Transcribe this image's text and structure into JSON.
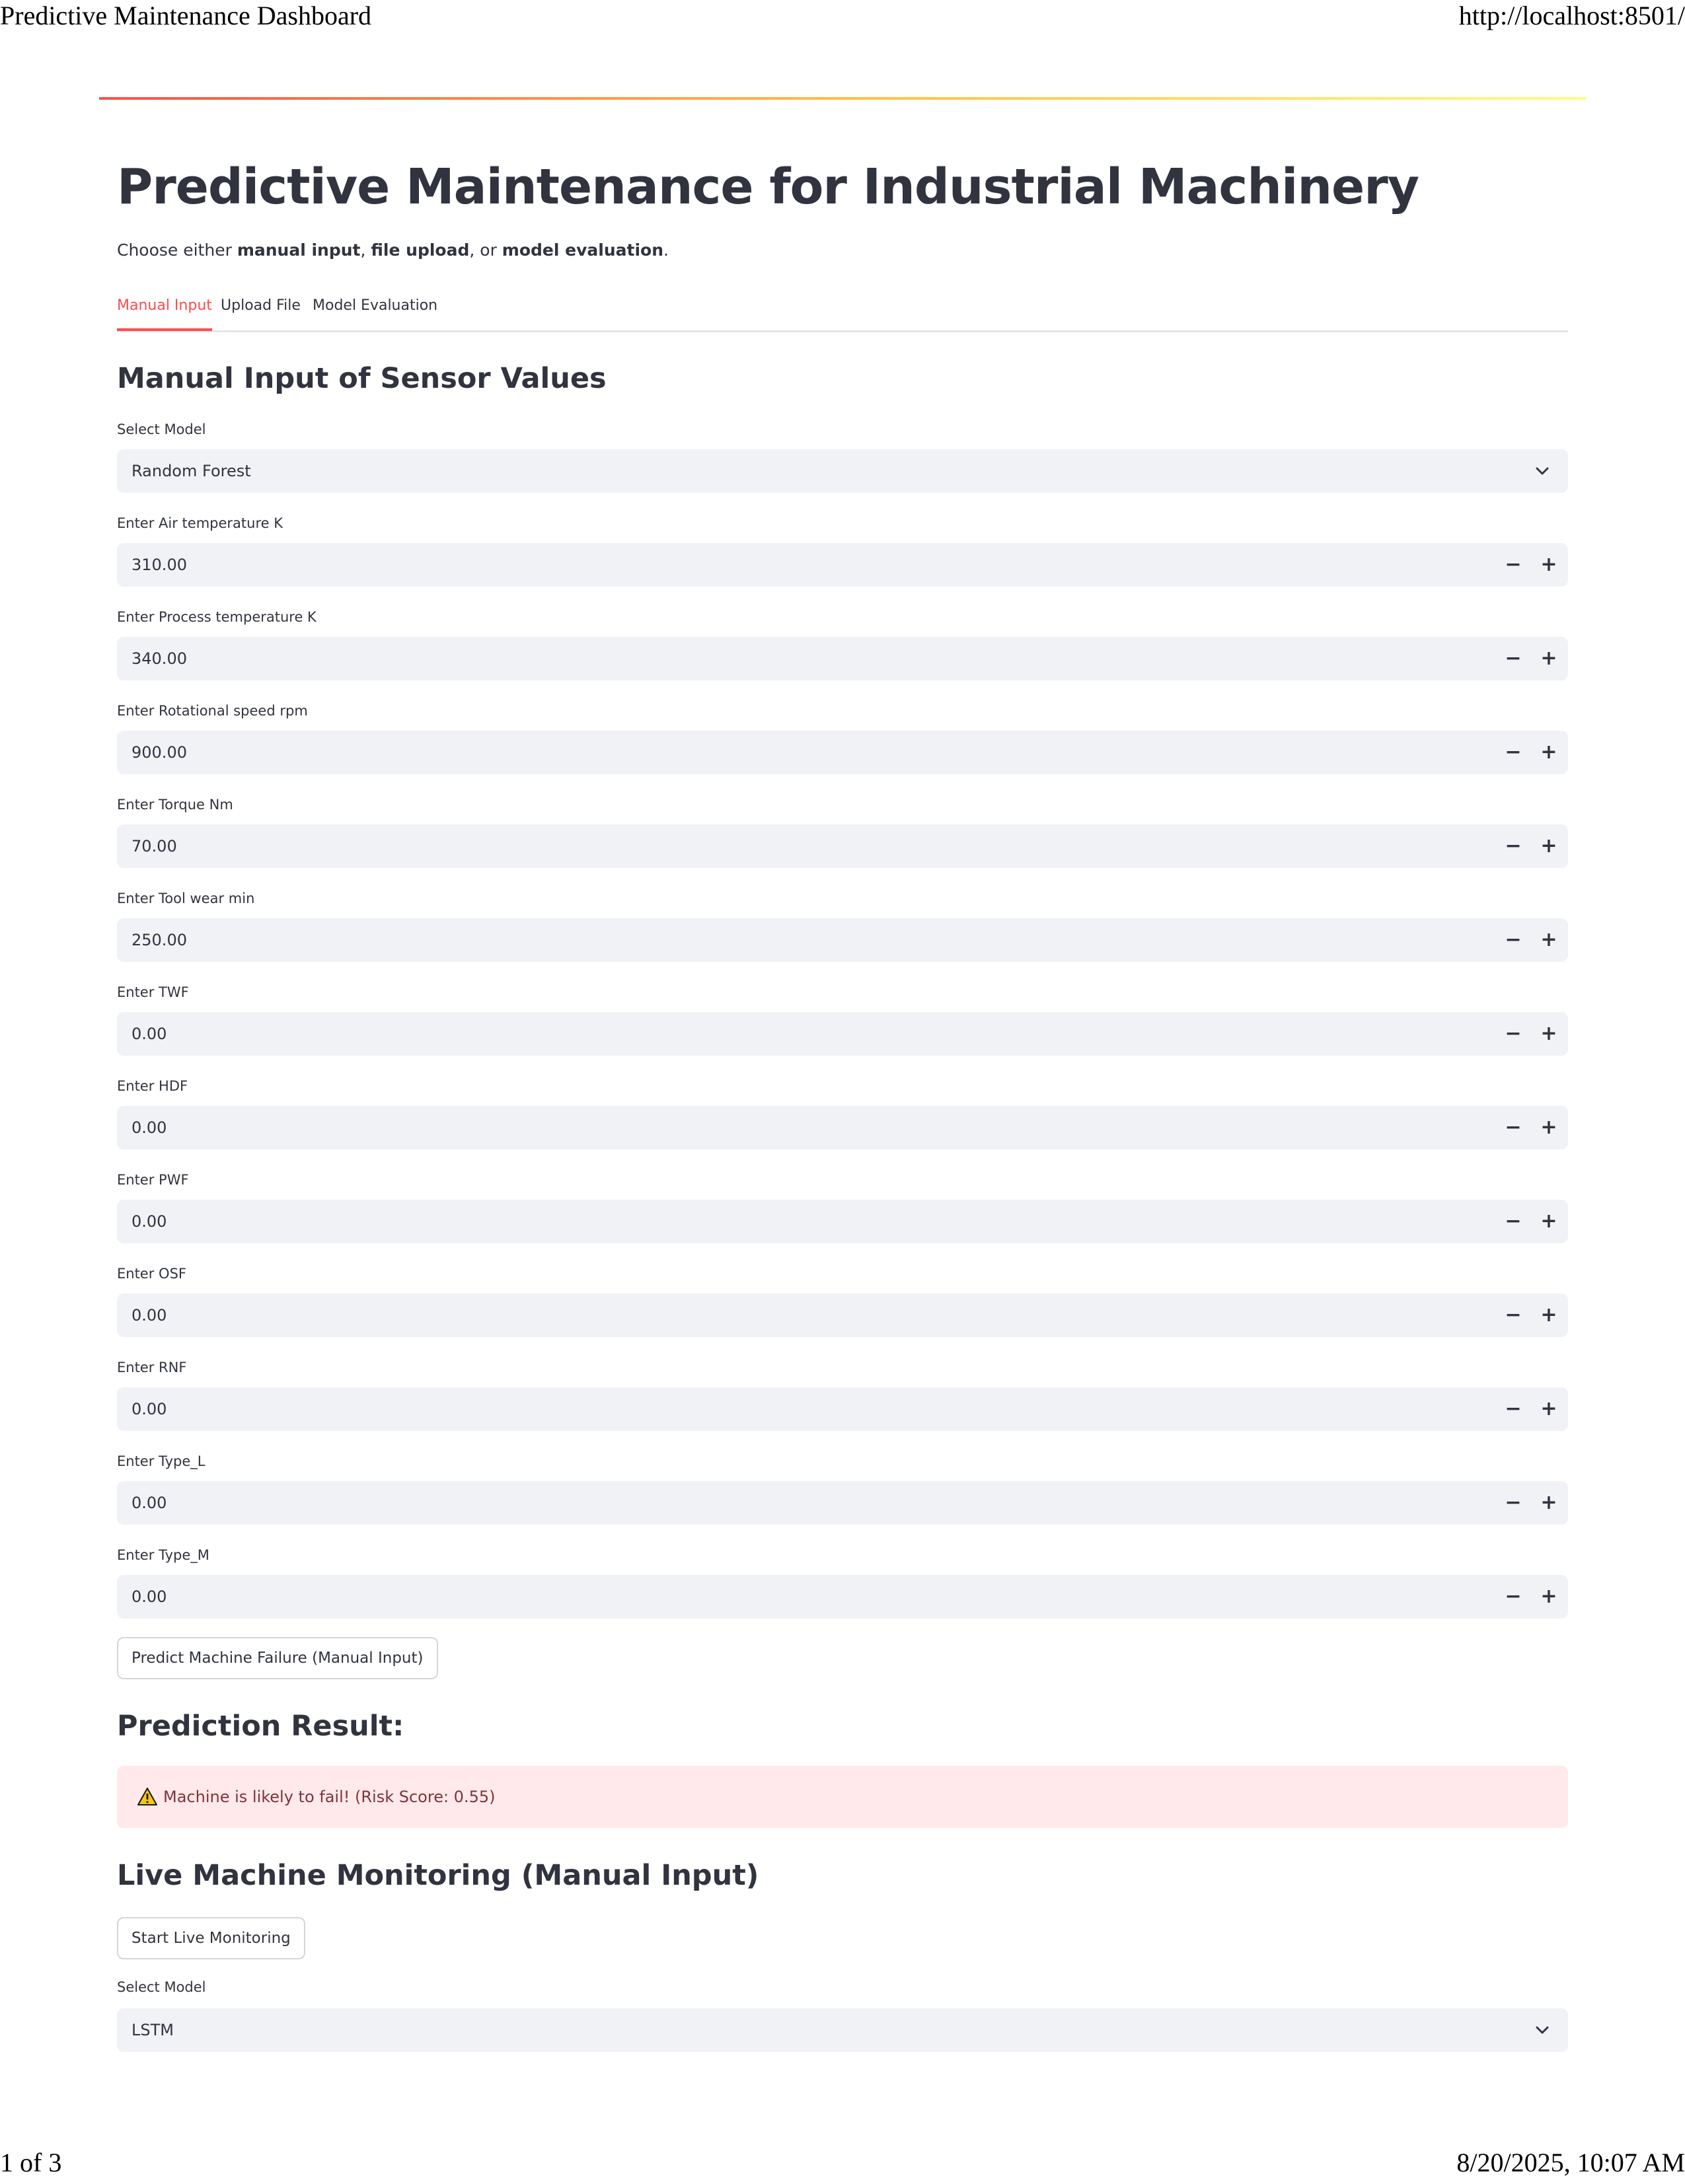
{
  "print_header": {
    "page_title": "Predictive Maintenance Dashboard",
    "url": "http://localhost:8501/"
  },
  "print_footer": {
    "page_count": "1 of 3",
    "datetime": "8/20/2025, 10:07 AM"
  },
  "colors": {
    "accent": "#ff4b4b",
    "input_bg": "#f0f2f6",
    "alert_bg": "#ffe9ea",
    "alert_text": "#7d353b",
    "text": "#31333f"
  },
  "header": {
    "title": "Predictive Maintenance for Industrial Machinery",
    "subtitle_prefix": "Choose either ",
    "subtitle_option1": "manual input",
    "subtitle_sep1": ", ",
    "subtitle_option2": "file upload",
    "subtitle_sep2": ", or ",
    "subtitle_option3": "model evaluation",
    "subtitle_suffix": "."
  },
  "tabs": [
    {
      "label": "Manual Input",
      "active": true
    },
    {
      "label": "Upload File",
      "active": false
    },
    {
      "label": "Model Evaluation",
      "active": false
    }
  ],
  "manual_input": {
    "heading": "Manual Input of Sensor Values",
    "model_select": {
      "label": "Select Model",
      "value": "Random Forest",
      "icon": "chevron-down-icon"
    },
    "fields": [
      {
        "label": "Enter Air temperature K",
        "value": "310.00"
      },
      {
        "label": "Enter Process temperature K",
        "value": "340.00"
      },
      {
        "label": "Enter Rotational speed rpm",
        "value": "900.00"
      },
      {
        "label": "Enter Torque Nm",
        "value": "70.00"
      },
      {
        "label": "Enter Tool wear min",
        "value": "250.00"
      },
      {
        "label": "Enter TWF",
        "value": "0.00"
      },
      {
        "label": "Enter HDF",
        "value": "0.00"
      },
      {
        "label": "Enter PWF",
        "value": "0.00"
      },
      {
        "label": "Enter OSF",
        "value": "0.00"
      },
      {
        "label": "Enter RNF",
        "value": "0.00"
      },
      {
        "label": "Enter Type_L",
        "value": "0.00"
      },
      {
        "label": "Enter Type_M",
        "value": "0.00"
      }
    ],
    "stepper": {
      "minus": "−",
      "plus": "+"
    },
    "predict_button": "Predict Machine Failure (Manual Input)"
  },
  "prediction": {
    "heading": "Prediction Result:",
    "icon": "warning-icon",
    "message": "Machine is likely to fail! (Risk Score: 0.55)"
  },
  "live_monitoring": {
    "heading": "Live Machine Monitoring (Manual Input)",
    "start_button": "Start Live Monitoring",
    "model_select": {
      "label": "Select Model",
      "value": "LSTM",
      "icon": "chevron-down-icon"
    }
  }
}
